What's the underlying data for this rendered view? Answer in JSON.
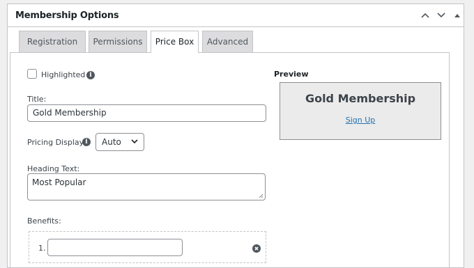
{
  "metabox": {
    "title": "Membership Options",
    "buttons": [
      {
        "name": "move-up-button",
        "icon": "chevron-up-icon"
      },
      {
        "name": "move-down-button",
        "icon": "chevron-down-icon"
      },
      {
        "name": "toggle-panel-button",
        "icon": "caret-up-icon"
      }
    ]
  },
  "tabs": [
    {
      "label": "Registration",
      "active": false
    },
    {
      "label": "Permissions",
      "active": false
    },
    {
      "label": "Price Box",
      "active": true
    },
    {
      "label": "Advanced",
      "active": false
    }
  ],
  "form": {
    "highlighted": {
      "label": "Highlighted",
      "checked": false,
      "info_icon": "info-icon"
    },
    "title": {
      "label": "Title:",
      "value": "Gold Membership"
    },
    "pricing_display": {
      "label": "Pricing Display",
      "selected": "Auto",
      "info_icon": "info-icon"
    },
    "heading_text": {
      "label": "Heading Text:",
      "value": "Most Popular"
    },
    "benefits": {
      "label": "Benefits:",
      "items": [
        {
          "number": "1.",
          "value": ""
        }
      ]
    }
  },
  "preview": {
    "label": "Preview",
    "title": "Gold Membership",
    "link": "Sign Up"
  },
  "colors": {
    "link": "#2271b1",
    "border": "#c3c4c7",
    "tab_inactive": "#dcdcde",
    "preview_bg": "#ebebeb"
  }
}
